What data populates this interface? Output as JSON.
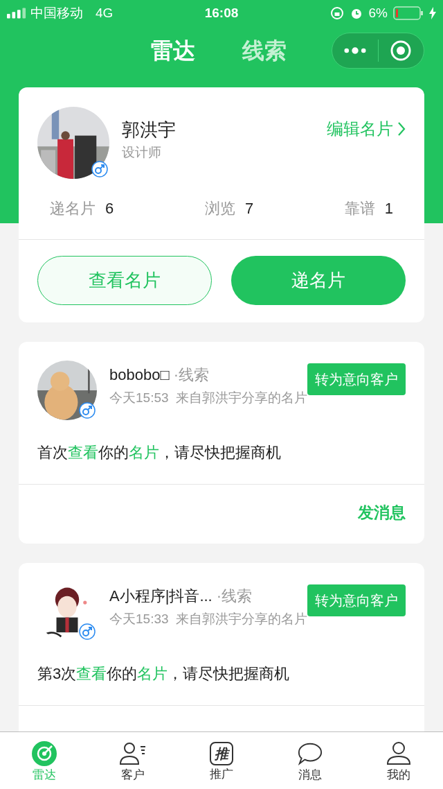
{
  "status_bar": {
    "carrier": "中国移动",
    "network": "4G",
    "time": "16:08",
    "battery": "6%"
  },
  "nav_tabs": [
    {
      "label": "雷达",
      "selected": true
    },
    {
      "label": "线索",
      "selected": false
    }
  ],
  "profile": {
    "name": "郭洪宇",
    "title": "设计师",
    "edit_link": "编辑名片",
    "stats": [
      {
        "label": "递名片",
        "value": "6"
      },
      {
        "label": "浏览",
        "value": "7"
      },
      {
        "label": "靠谱",
        "value": "1"
      }
    ],
    "buttons": [
      {
        "label": "查看名片",
        "kind": "outline"
      },
      {
        "label": "递名片",
        "kind": "filled"
      }
    ]
  },
  "feed": [
    {
      "name": "bobobo□",
      "tag": "·线索",
      "meta": "今天15:53  来自郭洪宇分享的名片",
      "action": "转为意向客户",
      "message": [
        {
          "text": "首次",
          "highlight": false
        },
        {
          "text": "查看",
          "highlight": true
        },
        {
          "text": "你的",
          "highlight": false
        },
        {
          "text": "名片",
          "highlight": true
        },
        {
          "text": "，请尽快把握商机",
          "highlight": false
        }
      ],
      "reply": "发消息"
    },
    {
      "name": "A小程序|抖音...",
      "tag": "·线索",
      "meta": "今天15:33  来自郭洪宇分享的名片",
      "action": "转为意向客户",
      "message": [
        {
          "text": "第3次",
          "highlight": false
        },
        {
          "text": "查看",
          "highlight": true
        },
        {
          "text": "你的",
          "highlight": false
        },
        {
          "text": "名片",
          "highlight": true
        },
        {
          "text": "，请尽快把握商机",
          "highlight": false
        }
      ]
    }
  ],
  "tab_bar": [
    {
      "label": "雷达",
      "kind": "radar",
      "selected": true
    },
    {
      "label": "客户",
      "kind": "customers",
      "selected": false
    },
    {
      "label": "推广",
      "kind": "promote",
      "icon_text": "推",
      "selected": false
    },
    {
      "label": "消息",
      "kind": "messages",
      "selected": false
    },
    {
      "label": "我的",
      "kind": "me",
      "selected": false
    }
  ]
}
